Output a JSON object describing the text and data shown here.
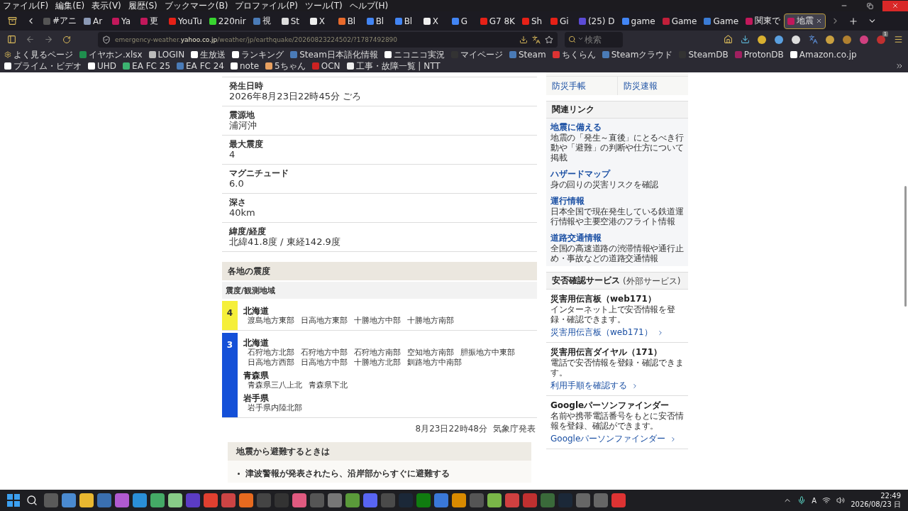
{
  "menu_bar": {
    "items": [
      "ファイル(F)",
      "編集(E)",
      "表示(V)",
      "履歴(S)",
      "ブックマーク(B)",
      "プロファイル(P)",
      "ツール(T)",
      "ヘルプ(H)"
    ]
  },
  "tabs": [
    {
      "label": "#アニ",
      "selected": false
    },
    {
      "label": "Ar",
      "selected": false
    },
    {
      "label": "Ya",
      "selected": false
    },
    {
      "label": "更",
      "selected": false
    },
    {
      "label": "YouTu",
      "selected": false
    },
    {
      "label": "220nir",
      "selected": false
    },
    {
      "label": "視",
      "selected": false
    },
    {
      "label": "St",
      "selected": false
    },
    {
      "label": "X",
      "selected": false
    },
    {
      "label": "Bl",
      "selected": false
    },
    {
      "label": "Bl",
      "selected": false
    },
    {
      "label": "Bl",
      "selected": false
    },
    {
      "label": "X",
      "selected": false
    },
    {
      "label": "G",
      "selected": false
    },
    {
      "label": "G7 8K",
      "selected": false
    },
    {
      "label": "Sh",
      "selected": false
    },
    {
      "label": "Gi",
      "selected": false
    },
    {
      "label": "(25) D",
      "selected": false
    },
    {
      "label": "game",
      "selected": false
    },
    {
      "label": "Game",
      "selected": false
    },
    {
      "label": "Game",
      "selected": false
    },
    {
      "label": "関東で",
      "selected": false
    },
    {
      "label": "地震",
      "selected": true
    }
  ],
  "address_bar": {
    "url_prefix": "emergency-weather.",
    "url_domain": "yahoo.co.jp",
    "url_path": "/weather/jp/earthquake/20260823224502/?1787492890"
  },
  "search": {
    "placeholder": "検索"
  },
  "toolbar": {
    "badge": "1"
  },
  "bookmarks": [
    "よく見るページ",
    "イヤホン.xlsx",
    "LOGIN",
    "生放送",
    "ランキング",
    "Steam日本語化情報",
    "ニコニコ実況",
    "マイページ",
    "Steam",
    "ちくらん",
    "Steamクラウド",
    "SteamDB",
    "ProtonDB",
    "Amazon.co.jp",
    "プライム・ビデオ",
    "UHD",
    "EA FC 25",
    "EA FC 24",
    "note",
    "5ちゃん",
    "OCN",
    "工事・故障一覧 | NTT"
  ],
  "quake_details": [
    {
      "label": "発生日時",
      "value": "2026年8月23日22時45分 ごろ"
    },
    {
      "label": "震源地",
      "value": "浦河沖"
    },
    {
      "label": "最大震度",
      "value": "4"
    },
    {
      "label": "マグニチュード",
      "value": "6.0"
    },
    {
      "label": "深さ",
      "value": "40km"
    },
    {
      "label": "緯度/経度",
      "value": "北緯41.8度 / 東経142.9度"
    }
  ],
  "intensity": {
    "title": "各地の震度",
    "header": "震度/観測地域",
    "levels": [
      {
        "intensity": "4",
        "color": "#f5ef3a",
        "regions": [
          {
            "name": "北海道",
            "areas": [
              "渡島地方東部",
              "日高地方東部",
              "十勝地方中部",
              "十勝地方南部"
            ]
          }
        ]
      },
      {
        "intensity": "3",
        "color": "#1450d8",
        "regions": [
          {
            "name": "北海道",
            "areas": [
              "石狩地方北部",
              "石狩地方中部",
              "石狩地方南部",
              "空知地方南部",
              "胆振地方中東部",
              "日高地方西部",
              "日高地方中部",
              "十勝地方北部",
              "釧路地方中南部"
            ]
          },
          {
            "name": "青森県",
            "areas": [
              "青森県三八上北",
              "青森県下北"
            ]
          },
          {
            "name": "岩手県",
            "areas": [
              "岩手県内陸北部"
            ]
          }
        ]
      }
    ],
    "issued_time": "8月23日22時48分",
    "issuer": "気象庁発表"
  },
  "evacuation": {
    "title": "地震から避難するときは",
    "items": [
      "津波警報が発表されたら、沿岸部からすぐに避難する"
    ]
  },
  "sidebar": {
    "grid": [
      "防災手帳",
      "防災速報"
    ],
    "related": {
      "title": "関連リンク",
      "items": [
        {
          "title": "地震に備える",
          "description": "地震の「発生～直後」にとるべき行動や「避難」の判断や仕方について掲載"
        },
        {
          "title": "ハザードマップ",
          "description": "身の回りの災害リスクを確認"
        },
        {
          "title": "運行情報",
          "description": "日本全国で現在発生している鉄道運行情報や主要空港のフライト情報"
        },
        {
          "title": "道路交通情報",
          "description": "全国の高速道路の渋滞情報や通行止め・事故などの道路交通情報"
        }
      ]
    },
    "safety": {
      "title": "安否確認サービス",
      "note": "(外部サービス)",
      "items": [
        {
          "title": "災害用伝言板（web171）",
          "description": "インターネット上で安否情報を登録・確認できます。",
          "link": "災害用伝言板（web171）"
        },
        {
          "title": "災害用伝言ダイヤル（171）",
          "description": "電話で安否情報を登録・確認できます。",
          "link": "利用手順を確認する"
        },
        {
          "title": "Googleパーソンファインダー",
          "description": "名前や携帯電話番号をもとに安否情報を登録、確認ができます。",
          "link": "Googleパーソンファインダー"
        }
      ]
    }
  },
  "taskbar": {
    "ime": "A",
    "time": "22:49",
    "date": "2026/08/23 日"
  }
}
